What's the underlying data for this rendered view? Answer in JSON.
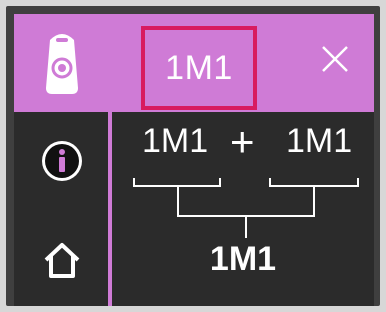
{
  "sidebar": {
    "items": [
      {
        "name": "device-icon",
        "interactable": true
      },
      {
        "name": "info-icon",
        "interactable": true
      },
      {
        "name": "home-icon",
        "interactable": true
      }
    ]
  },
  "topbar": {
    "tab_label": "1M1",
    "close_icon": "close-icon"
  },
  "equation": {
    "left": "1M1",
    "operator": "+",
    "right": "1M1",
    "result": "1M1"
  },
  "colors": {
    "accent": "#cf7bd6",
    "highlight": "#d81b60",
    "background": "#2b2b2b",
    "text": "#ffffff"
  }
}
